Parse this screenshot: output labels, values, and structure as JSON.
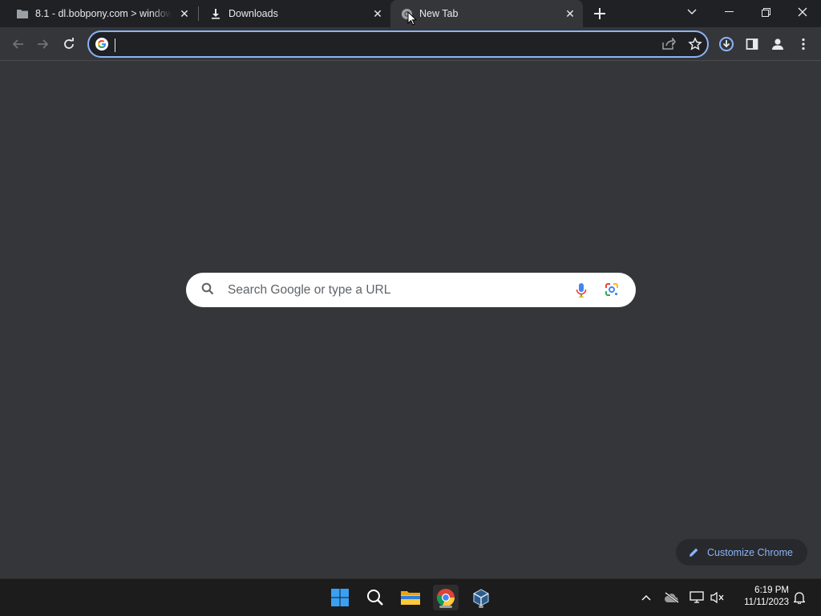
{
  "tabs": [
    {
      "title": "8.1 - dl.bobpony.com > window",
      "icon": "folder-icon",
      "active": false
    },
    {
      "title": "Downloads",
      "icon": "download-icon",
      "active": false
    },
    {
      "title": "New Tab",
      "icon": "chrome-icon",
      "active": true
    }
  ],
  "omnibox": {
    "value": "",
    "placeholder": ""
  },
  "search": {
    "placeholder": "Search Google or type a URL"
  },
  "customize": {
    "label": "Customize Chrome"
  },
  "clock": {
    "time": "6:19 PM",
    "date": "11/11/2023"
  },
  "colors": {
    "accent": "#8ab4f8",
    "background": "#35363a",
    "tabstrip": "#202124",
    "taskbar": "#1c1c1c"
  }
}
